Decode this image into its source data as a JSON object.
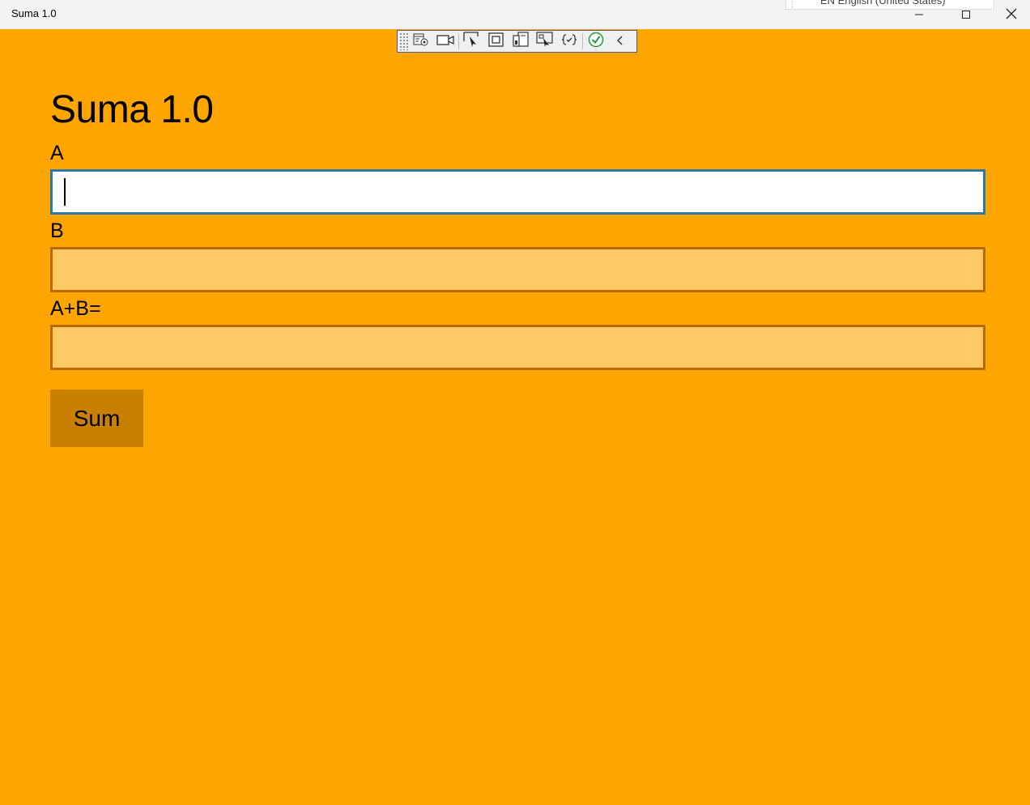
{
  "window": {
    "title": "Suma 1.0",
    "language_bar": {
      "grip": "⋮",
      "text": "EN English (United States)"
    },
    "controls": [
      "minimize-icon",
      "maximize-icon",
      "close-icon"
    ]
  },
  "debug_toolbar": {
    "icons": [
      "grip",
      "live-visual-tree-icon",
      "camera-icon",
      "select-element-icon",
      "display-layout-adorners-icon",
      "track-focus-icon",
      "select-element-hover-icon",
      "binding-failures-icon",
      "accessibility-check-icon",
      "collapse-chevron-icon"
    ]
  },
  "app": {
    "title": "Suma 1.0",
    "fields": [
      {
        "label": "A",
        "value": ""
      },
      {
        "label": "B",
        "value": ""
      },
      {
        "label": "A+B=",
        "value": ""
      }
    ],
    "sum_button": "Sum"
  },
  "colors": {
    "background": "#FFA500",
    "field_fill": "#FFC966",
    "field_border": "#b86a00",
    "focused_border": "#2a7ab0",
    "button": "#C98000"
  }
}
